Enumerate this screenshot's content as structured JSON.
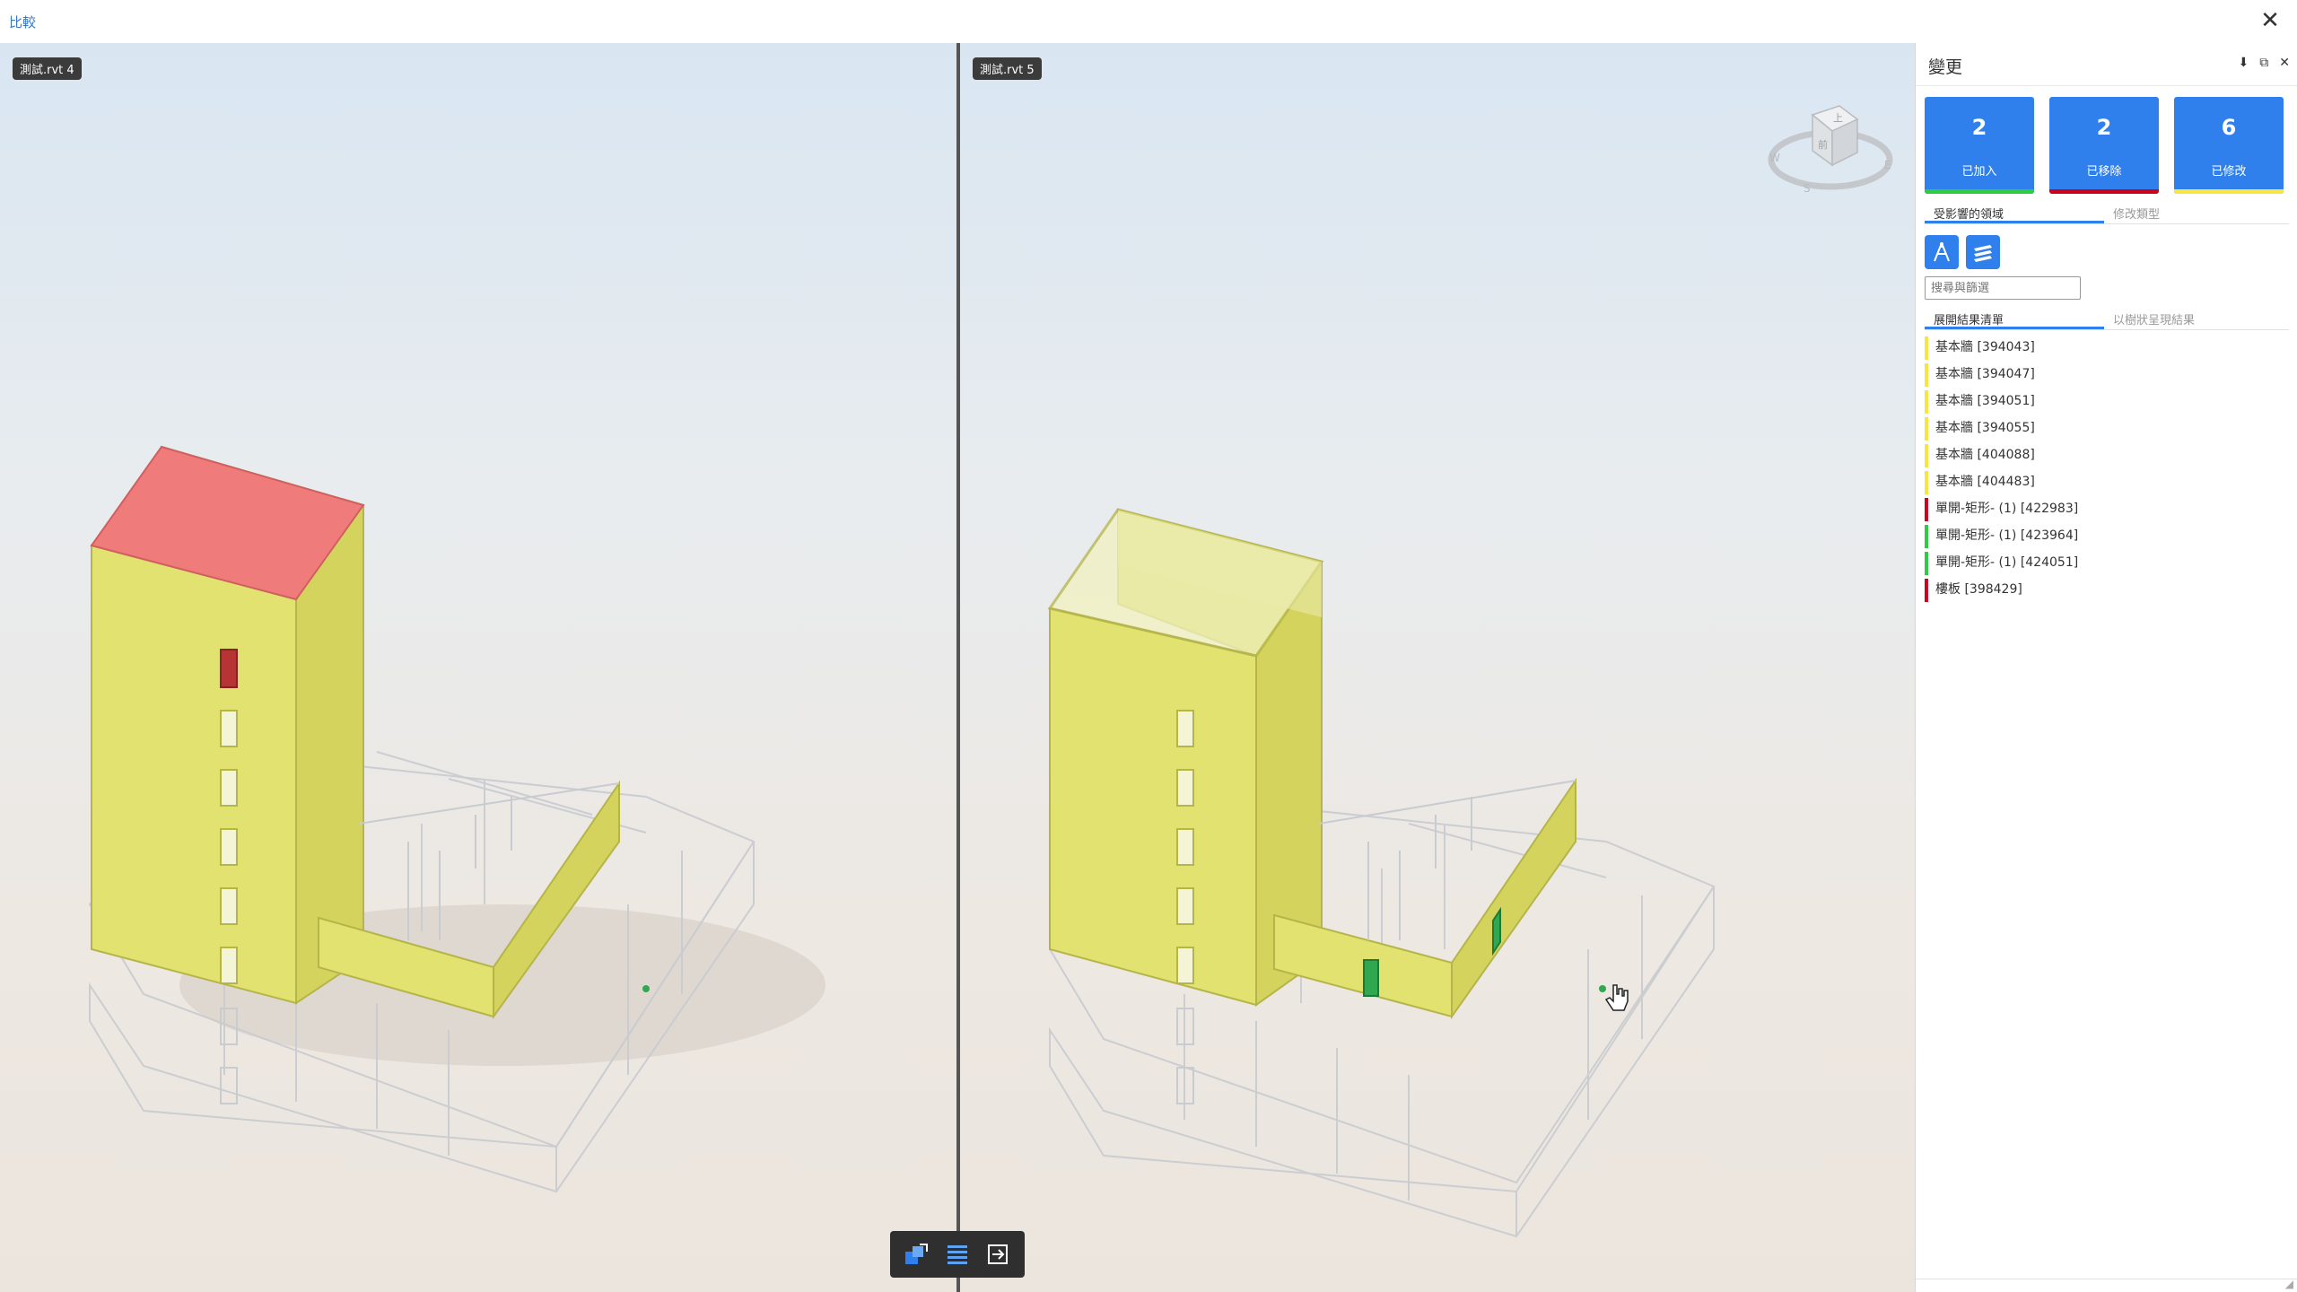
{
  "window": {
    "title": "比較",
    "close_glyph": "✕"
  },
  "viewports": {
    "left": {
      "label": "測試.rvt 4"
    },
    "right": {
      "label": "測試.rvt 5"
    }
  },
  "viewcube": {
    "face_top": "上",
    "face_front": "前",
    "compass_w": "W",
    "compass_s": "S",
    "compass_e": "E"
  },
  "toolbar": {
    "buttons": [
      {
        "icon": "sync-views-icon"
      },
      {
        "icon": "layers-icon"
      },
      {
        "icon": "exit-compare-icon"
      }
    ]
  },
  "panel": {
    "title": "變更",
    "icons": [
      "download-icon",
      "popout-icon",
      "close-icon"
    ],
    "stats": [
      {
        "count": "2",
        "label": "已加入",
        "color": "#2ecc40"
      },
      {
        "count": "2",
        "label": "已移除",
        "color": "#d0021b"
      },
      {
        "count": "6",
        "label": "已修改",
        "color": "#f5e642"
      }
    ],
    "tabs_top": [
      "受影響的領域",
      "修改類型"
    ],
    "search_placeholder": "搜尋與篩選",
    "tabs_results": [
      "展開結果清單",
      "以樹狀呈現結果"
    ],
    "results": [
      {
        "label": "基本牆 [394043]",
        "color": "#f5e642"
      },
      {
        "label": "基本牆 [394047]",
        "color": "#f5e642"
      },
      {
        "label": "基本牆 [394051]",
        "color": "#f5e642"
      },
      {
        "label": "基本牆 [394055]",
        "color": "#f5e642"
      },
      {
        "label": "基本牆 [404088]",
        "color": "#f5e642"
      },
      {
        "label": "基本牆 [404483]",
        "color": "#f5e642"
      },
      {
        "label": "單開-矩形- (1) [422983]",
        "color": "#d0021b"
      },
      {
        "label": "單開-矩形- (1) [423964]",
        "color": "#2ecc40"
      },
      {
        "label": "單開-矩形- (1) [424051]",
        "color": "#2ecc40"
      },
      {
        "label": "樓板 [398429]",
        "color": "#d0021b"
      }
    ]
  },
  "colors": {
    "accent": "#2f80ed",
    "wall": "#dede6a",
    "removed_slab": "#ef7b7b",
    "added_door": "#2fa84f"
  }
}
